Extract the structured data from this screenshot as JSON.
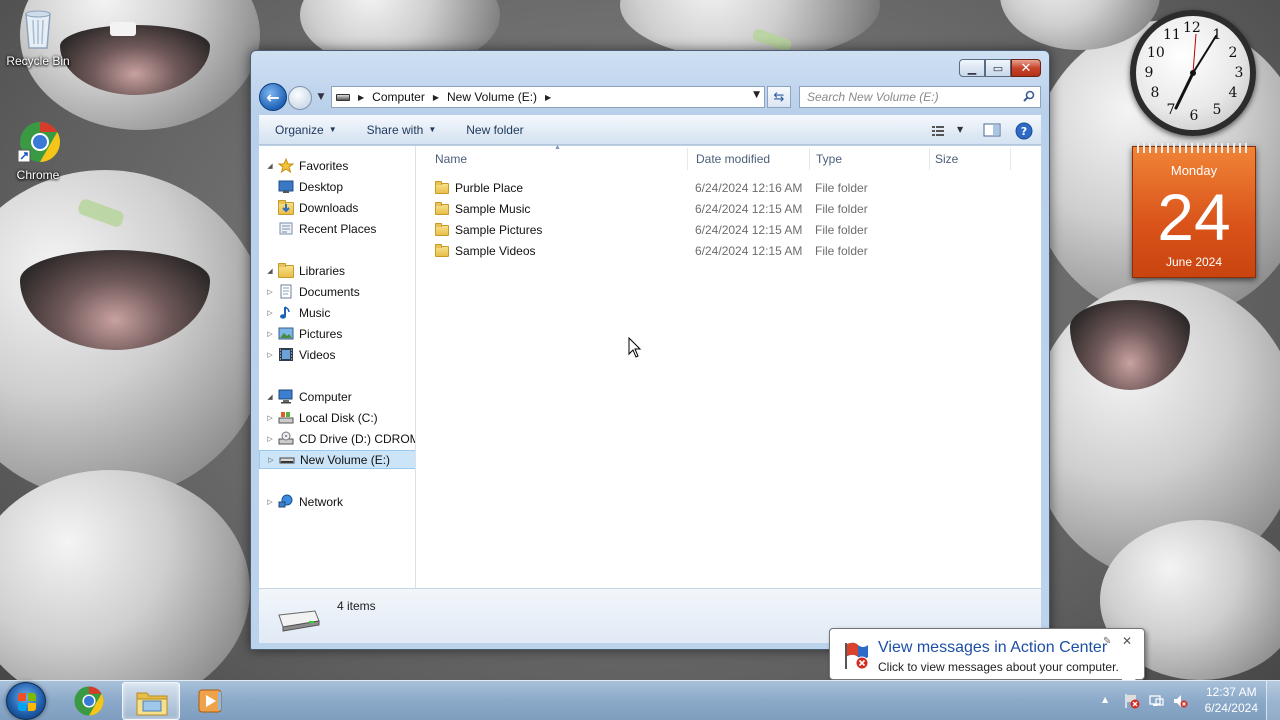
{
  "desktop": {
    "icons": [
      {
        "label": "Recycle Bin",
        "icon": "recycle-bin-icon"
      },
      {
        "label": "Chrome",
        "icon": "chrome-icon"
      }
    ]
  },
  "window": {
    "address": {
      "crumbs": [
        "Computer",
        "New Volume (E:)"
      ]
    },
    "search": {
      "placeholder": "Search New Volume (E:)"
    },
    "toolbar": {
      "organize": "Organize",
      "share_with": "Share with",
      "new_folder": "New folder"
    },
    "nav": {
      "favorites": "Favorites",
      "desktop": "Desktop",
      "downloads": "Downloads",
      "recent_places": "Recent Places",
      "libraries": "Libraries",
      "documents": "Documents",
      "music": "Music",
      "pictures": "Pictures",
      "videos": "Videos",
      "computer": "Computer",
      "local_disk": "Local Disk (C:)",
      "cd_drive": "CD Drive (D:) CDROM",
      "new_volume": "New Volume (E:)",
      "network": "Network"
    },
    "columns": {
      "name": "Name",
      "date": "Date modified",
      "type": "Type",
      "size": "Size"
    },
    "files": [
      {
        "name": "Purble Place",
        "date": "6/24/2024 12:16 AM",
        "type": "File folder"
      },
      {
        "name": "Sample Music",
        "date": "6/24/2024 12:15 AM",
        "type": "File folder"
      },
      {
        "name": "Sample Pictures",
        "date": "6/24/2024 12:15 AM",
        "type": "File folder"
      },
      {
        "name": "Sample Videos",
        "date": "6/24/2024 12:15 AM",
        "type": "File folder"
      }
    ],
    "status": {
      "count": "4 items"
    }
  },
  "gadgets": {
    "clock": {
      "numbers": [
        "12",
        "1",
        "2",
        "3",
        "4",
        "5",
        "6",
        "7",
        "8",
        "9",
        "10",
        "11"
      ]
    },
    "calendar": {
      "weekday": "Monday",
      "day": "24",
      "month_year": "June 2024"
    }
  },
  "balloon": {
    "title": "View messages in Action Center",
    "message": "Click to view messages about your computer."
  },
  "taskbar": {
    "time": "12:37 AM",
    "date": "6/24/2024"
  }
}
